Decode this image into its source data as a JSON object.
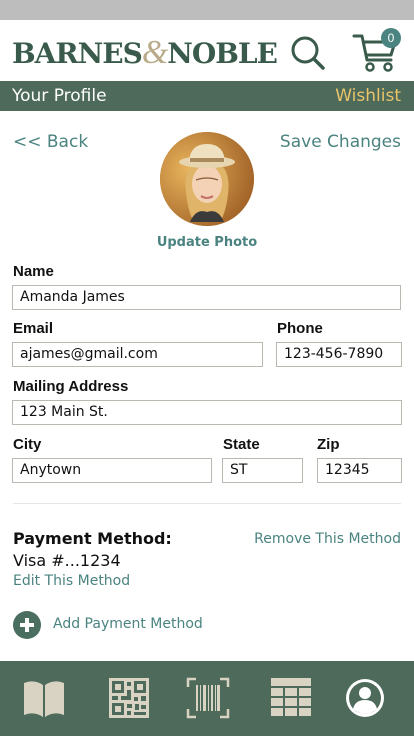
{
  "header": {
    "logo_left": "BARNES",
    "logo_amp": "&",
    "logo_right": "NOBLE",
    "cart_count": "0",
    "search_icon": "search-icon",
    "cart_icon": "cart-icon"
  },
  "title_bar": {
    "title": "Your Profile",
    "wishlist": "Wishlist"
  },
  "profile": {
    "back": "<< Back",
    "save": "Save Changes",
    "update_photo": "Update Photo"
  },
  "form": {
    "name_label": "Name",
    "name_value": "Amanda James",
    "email_label": "Email",
    "email_value": "ajames@gmail.com",
    "phone_label": "Phone",
    "phone_value": "123-456-7890",
    "address_label": "Mailing Address",
    "address_value": "123 Main St.",
    "city_label": "City",
    "city_value": "Anytown",
    "state_label": "State",
    "state_value": "ST",
    "zip_label": "Zip",
    "zip_value": "12345"
  },
  "payment": {
    "title": "Payment Method:",
    "card": "Visa #...1234",
    "edit": "Edit This Method",
    "remove": "Remove This Method",
    "add": "Add Payment Method"
  },
  "bottom_nav": {
    "items": [
      "book-icon",
      "qr-code-icon",
      "barcode-scan-icon",
      "grid-icon",
      "profile-icon"
    ]
  },
  "colors": {
    "brand_green": "#4d6a5a",
    "link_teal": "#4a8380",
    "wishlist_gold": "#e9c46a",
    "logo_amp_tan": "#b9ab8a"
  }
}
